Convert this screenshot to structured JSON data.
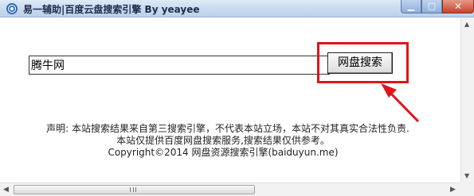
{
  "window": {
    "title": "易一辅助|百度云盘搜索引擎 By yeayee",
    "minimize_glyph": "▁",
    "maximize_glyph": "□",
    "close_glyph": "✕"
  },
  "search": {
    "value": "腾牛网",
    "button_label": "网盘搜索"
  },
  "notice": {
    "line1": "声明: 本站搜索结果来自第三搜索引擎，不代表本站立场，本站不对其真实合法性负责.",
    "line2": "本站仅提供百度网盘搜索服务,搜索结果仅供参考。",
    "line3": "Copyright©2014 网盘资源搜索引擎(baiduyun.me)"
  },
  "scrollbars": {
    "up_glyph": "▲",
    "down_glyph": "▼",
    "left_glyph": "◀",
    "right_glyph": "▶"
  },
  "colors": {
    "highlight": "#e2141a",
    "titlebar": "#c9dbef"
  }
}
